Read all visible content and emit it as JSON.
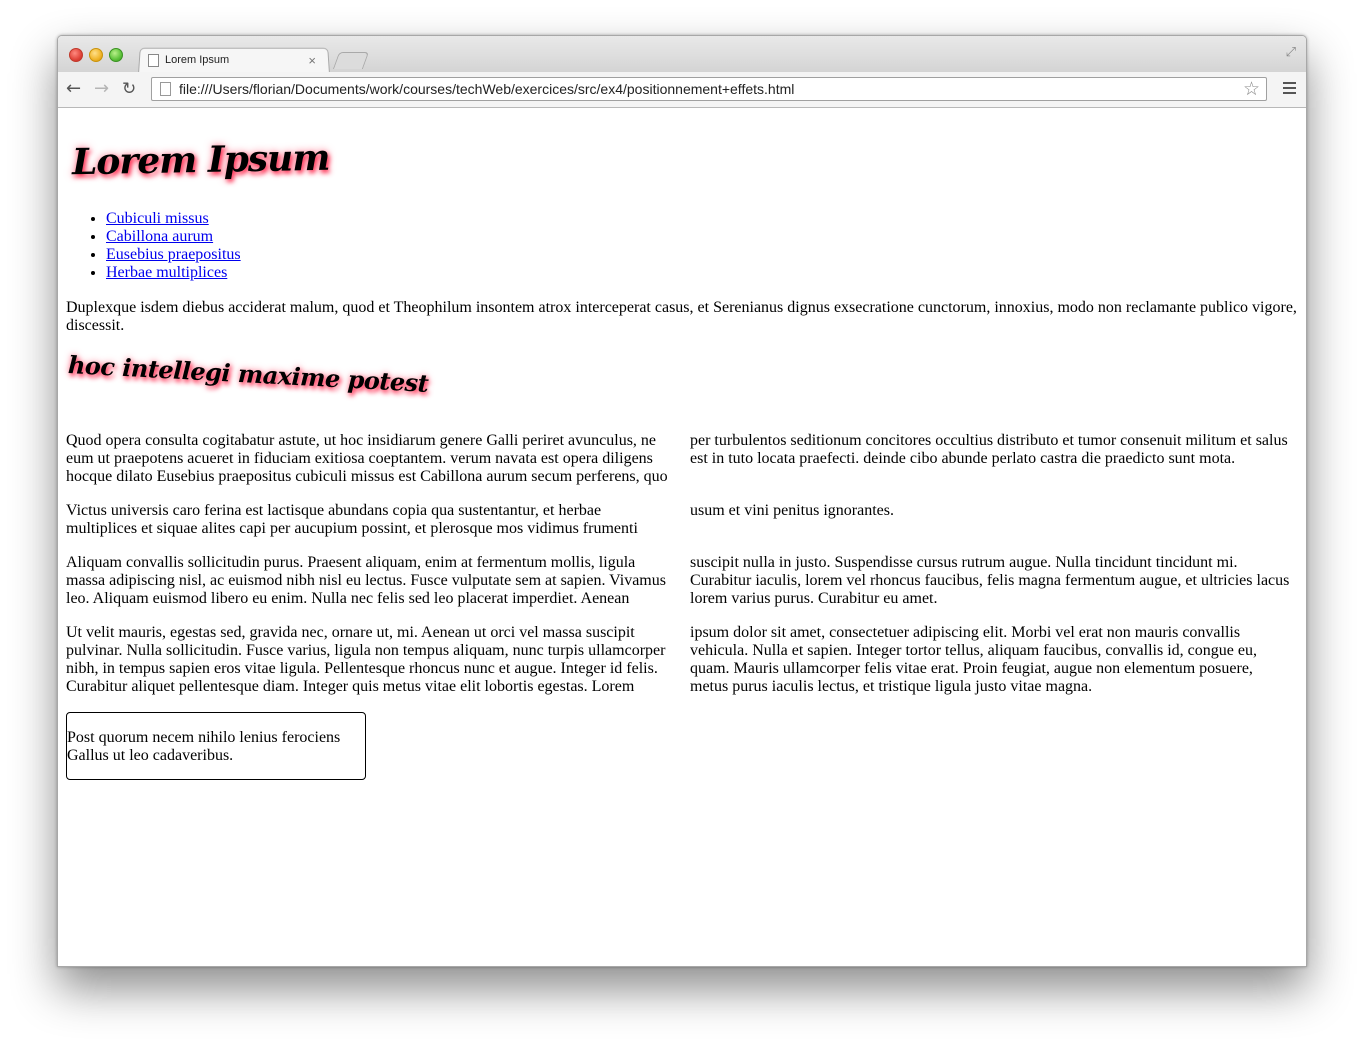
{
  "browser": {
    "tab_title": "Lorem Ipsum",
    "tab_close": "×",
    "url": "file:///Users/florian/Documents/work/courses/techWeb/exercices/src/ex4/positionnement+effets.html",
    "back": "←",
    "forward": "→",
    "reload": "↻",
    "star": "☆",
    "expand": "⤢"
  },
  "page": {
    "title": "Lorem Ipsum",
    "nav": [
      "Cubiculi missus",
      "Cabillona aurum",
      "Eusebius praepositus",
      "Herbae multiplices"
    ],
    "intro": "Duplexque isdem diebus acciderat malum, quod et Theophilum insontem atrox interceperat casus, et Serenianus dignus exsecratione cunctorum, innoxius, modo non reclamante publico vigore, discessit.",
    "subtitle": "hoc intellegi maxime potest",
    "left_column": [
      "Quod opera consulta cogitabatur astute, ut hoc insidiarum genere Galli periret avunculus, ne eum ut praepotens acueret in fiduciam exitiosa coeptantem. verum navata est opera diligens hocque dilato Eusebius praepositus cubiculi missus est Cabillona aurum secum perferens, quo",
      "Victus universis caro ferina est lactisque abundans copia qua sustentantur, et herbae multiplices et siquae alites capi per aucupium possint, et plerosque mos vidimus frumenti",
      "Aliquam convallis sollicitudin purus. Praesent aliquam, enim at fermentum mollis, ligula massa adipiscing nisl, ac euismod nibh nisl eu lectus. Fusce vulputate sem at sapien. Vivamus leo. Aliquam euismod libero eu enim. Nulla nec felis sed leo placerat imperdiet. Aenean",
      "Ut velit mauris, egestas sed, gravida nec, ornare ut, mi. Aenean ut orci vel massa suscipit pulvinar. Nulla sollicitudin. Fusce varius, ligula non tempus aliquam, nunc turpis ullamcorper nibh, in tempus sapien eros vitae ligula. Pellentesque rhoncus nunc et augue. Integer id felis. Curabitur aliquet pellentesque diam. Integer quis metus vitae elit lobortis egestas. Lorem"
    ],
    "right_column": [
      "per turbulentos seditionum concitores occultius distributo et tumor consenuit militum et salus est in tuto locata praefecti. deinde cibo abunde perlato castra die praedicto sunt mota.",
      "usum et vini penitus ignorantes.",
      "suscipit nulla in justo. Suspendisse cursus rutrum augue. Nulla tincidunt tincidunt mi. Curabitur iaculis, lorem vel rhoncus faucibus, felis magna fermentum augue, et ultricies lacus lorem varius purus. Curabitur eu amet.",
      "ipsum dolor sit amet, consectetuer adipiscing elit. Morbi vel erat non mauris convallis vehicula. Nulla et sapien. Integer tortor tellus, aliquam faucibus, convallis id, congue eu, quam. Mauris ullamcorper felis vitae erat. Proin feugiat, augue non elementum posuere, metus purus iaculis lectus, et tristique ligula justo vitae magna."
    ],
    "box_text": "Post quorum necem nihilo lenius ferociens Gallus ut leo cadaveribus."
  },
  "colors": {
    "link": "#0000ee",
    "heading_glow": "#ff3a5c"
  }
}
